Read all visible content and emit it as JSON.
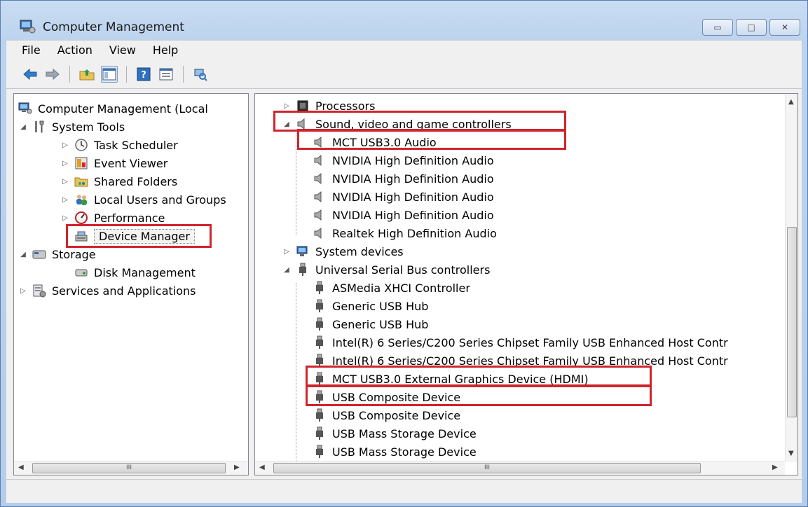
{
  "window": {
    "title": "Computer Management",
    "controls": {
      "minimize": "▭",
      "maximize": "□",
      "close": "✕"
    }
  },
  "menu": [
    "File",
    "Action",
    "View",
    "Help"
  ],
  "toolbar": [
    "back-icon",
    "forward-icon",
    "up-folder-icon",
    "show-hide-tree-icon",
    "help-icon",
    "properties-icon",
    "scan-hardware-icon"
  ],
  "tree": {
    "root": "Computer Management (Local",
    "system_tools": "System Tools",
    "task_scheduler": "Task Scheduler",
    "event_viewer": "Event Viewer",
    "shared_folders": "Shared Folders",
    "local_users": "Local Users and Groups",
    "performance": "Performance",
    "device_manager": "Device Manager",
    "storage": "Storage",
    "disk_management": "Disk Management",
    "services": "Services and Applications"
  },
  "devices": {
    "processors": "Processors",
    "sound": "Sound, video and game controllers",
    "mct_audio": "MCT USB3.0 Audio",
    "nvidia1": "NVIDIA High Definition Audio",
    "nvidia2": "NVIDIA High Definition Audio",
    "nvidia3": "NVIDIA High Definition Audio",
    "nvidia4": "NVIDIA High Definition Audio",
    "realtek": "Realtek High Definition Audio",
    "system_devices": "System devices",
    "usb": "Universal Serial Bus controllers",
    "asmedia": "ASMedia XHCI Controller",
    "hub1": "Generic USB Hub",
    "hub2": "Generic USB Hub",
    "intel1": "Intel(R) 6 Series/C200 Series Chipset Family USB Enhanced Host Contr",
    "intel2": "Intel(R) 6 Series/C200 Series Chipset Family USB Enhanced Host Contr",
    "mct_graphics": "MCT USB3.0 External Graphics Device (HDMI)",
    "composite1": "USB Composite Device",
    "composite2": "USB Composite Device",
    "mass1": "USB Mass Storage Device",
    "mass2": "USB Mass Storage Device"
  },
  "scroll": {
    "grip": "III"
  }
}
